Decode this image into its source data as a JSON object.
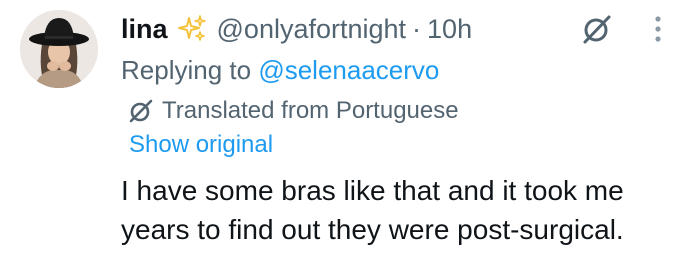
{
  "author": {
    "display_name": "lina",
    "badge_icon": "sparkles-icon",
    "handle": "@onlyafortnight",
    "separator": "·",
    "timestamp": "10h"
  },
  "reply": {
    "prefix": "Replying to ",
    "mention": "@selenaacervo"
  },
  "translation": {
    "label": "Translated from Portuguese",
    "show_original": "Show original"
  },
  "body": {
    "line1": "I have some bras like that and it took me",
    "line2": "years to find out they were post-surgical."
  },
  "colors": {
    "text": "#0f1419",
    "secondary": "#536471",
    "link": "#1d9bf0",
    "sparkle": "#f5c33b"
  }
}
